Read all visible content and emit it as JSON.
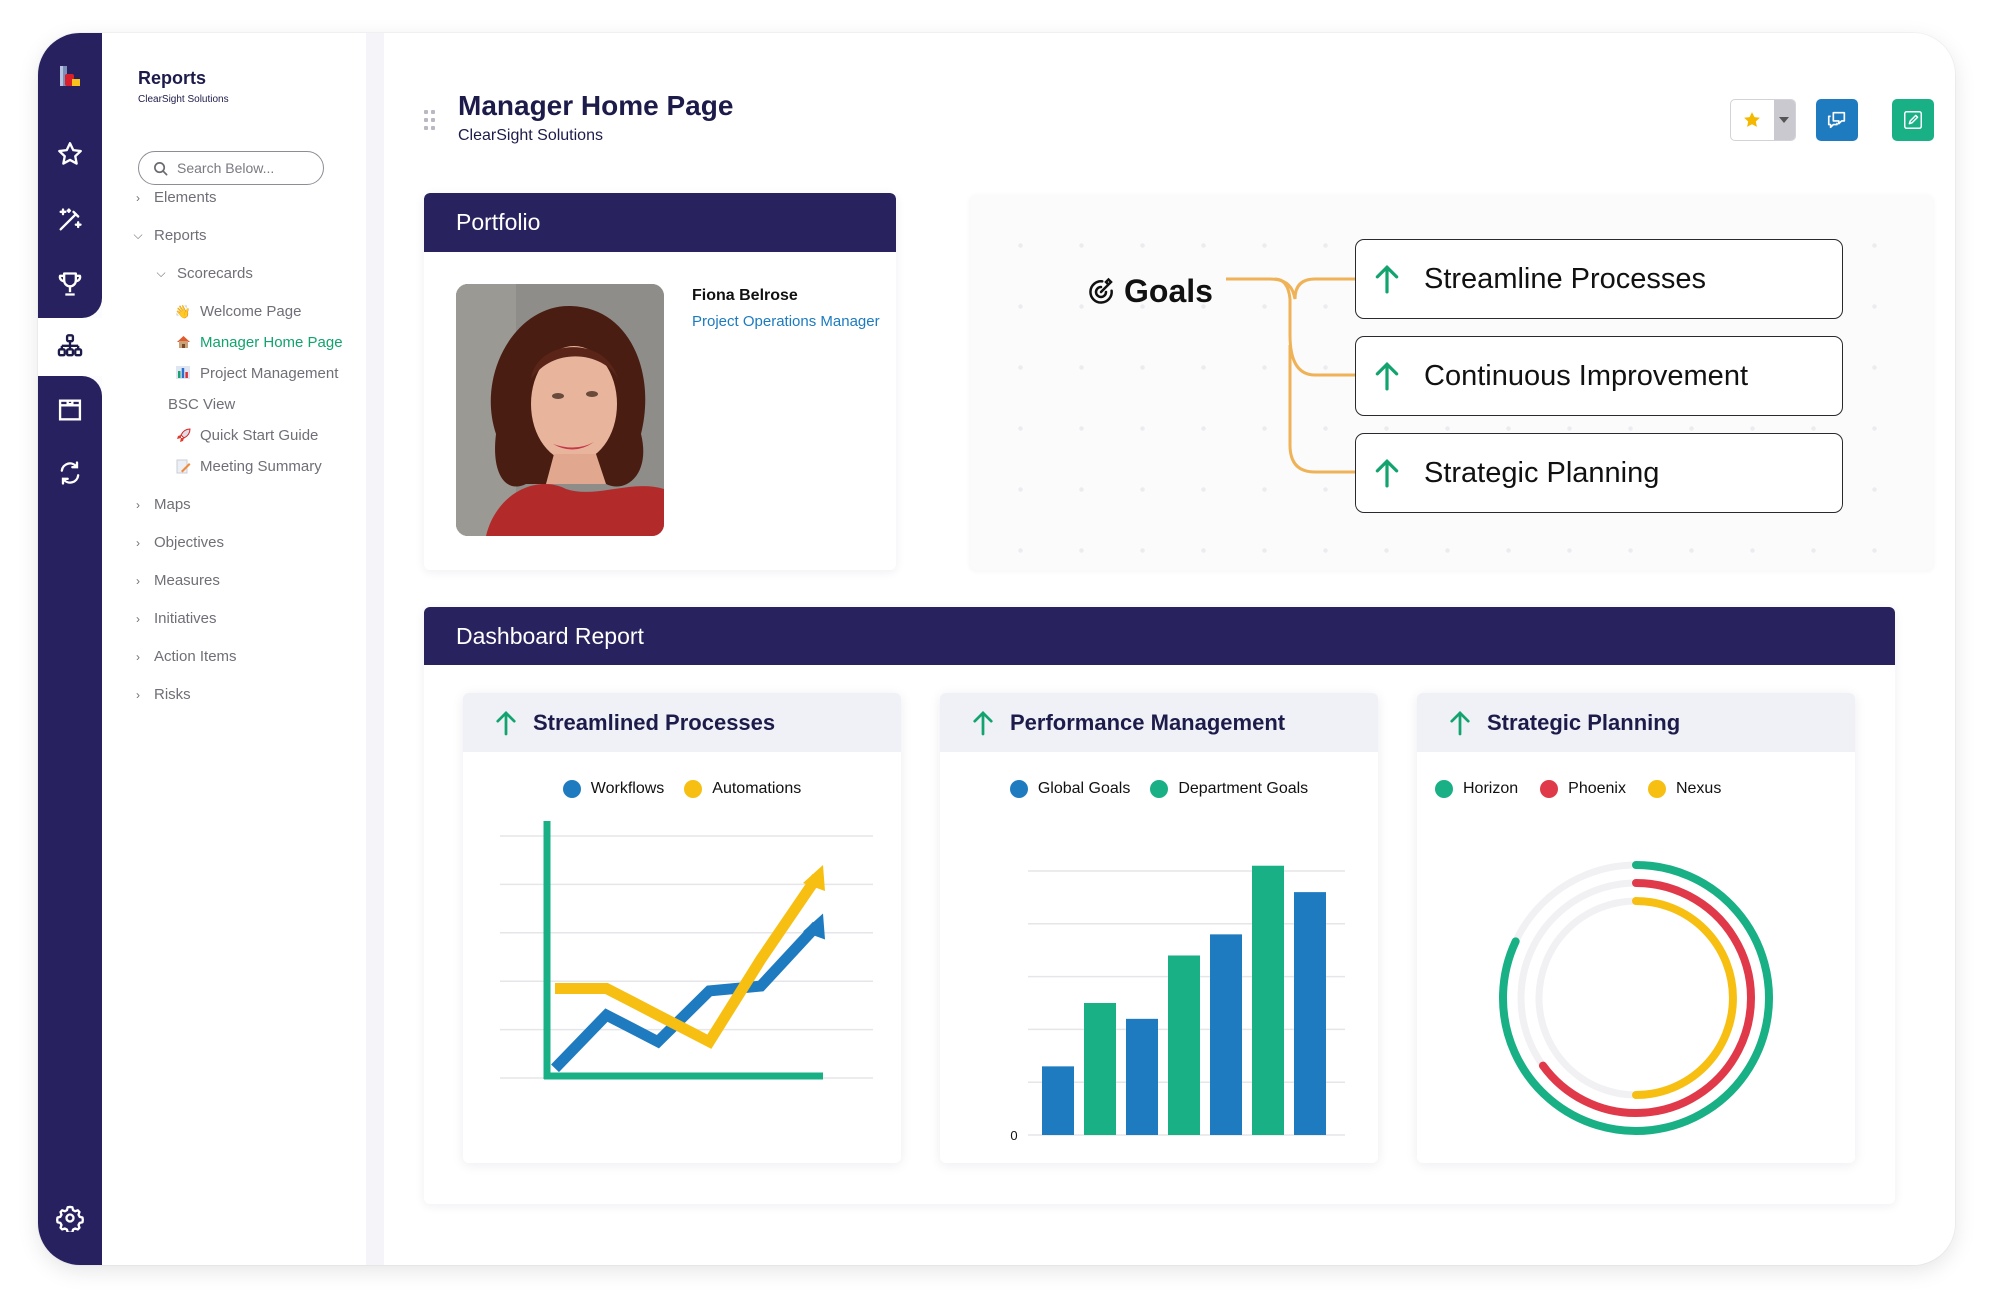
{
  "rail": {
    "items": [
      {
        "name": "app-logo-icon"
      },
      {
        "name": "favorites-star-icon"
      },
      {
        "name": "magic-wand-icon"
      },
      {
        "name": "trophy-icon"
      },
      {
        "name": "hierarchy-icon",
        "active": true
      },
      {
        "name": "archive-box-icon"
      },
      {
        "name": "sync-icon"
      },
      {
        "name": "settings-gear-icon"
      }
    ]
  },
  "nav": {
    "title": "Reports",
    "subtitle": "ClearSight Solutions",
    "search_placeholder": "Search Below...",
    "tree": [
      {
        "label": "Elements",
        "state": "collapsed",
        "level": 0
      },
      {
        "label": "Reports",
        "state": "expanded",
        "level": 0
      },
      {
        "label": "Scorecards",
        "state": "expanded",
        "level": 1
      },
      {
        "label": "Welcome Page",
        "icon": "hand-icon",
        "level": 2
      },
      {
        "label": "Manager Home Page",
        "icon": "house-icon",
        "level": 2,
        "active": true
      },
      {
        "label": "Project Management",
        "icon": "bar-chart-icon",
        "level": 2
      },
      {
        "label": "BSC View",
        "icon": null,
        "level": 2
      },
      {
        "label": "Quick Start Guide",
        "icon": "rocket-icon",
        "level": 2
      },
      {
        "label": "Meeting Summary",
        "icon": "memo-icon",
        "level": 2
      },
      {
        "label": "Maps",
        "state": "collapsed",
        "level": 0
      },
      {
        "label": "Objectives",
        "state": "collapsed",
        "level": 0
      },
      {
        "label": "Measures",
        "state": "collapsed",
        "level": 0
      },
      {
        "label": "Initiatives",
        "state": "collapsed",
        "level": 0
      },
      {
        "label": "Action Items",
        "state": "collapsed",
        "level": 0
      },
      {
        "label": "Risks",
        "state": "collapsed",
        "level": 0
      }
    ]
  },
  "header": {
    "title": "Manager Home Page",
    "subtitle": "ClearSight Solutions",
    "toolbar": {
      "favorite_icon": "star-icon",
      "favorite_menu_icon": "caret-down-icon",
      "comments_icon": "chat-bubbles-icon",
      "edit_icon": "edit-pencil-icon"
    }
  },
  "portfolio": {
    "title": "Portfolio",
    "name": "Fiona Belrose",
    "role": "Project Operations Manager"
  },
  "goals": {
    "label": "Goals",
    "items": [
      {
        "label": "Streamline Processes",
        "trend": "up"
      },
      {
        "label": "Continuous Improvement",
        "trend": "up"
      },
      {
        "label": "Strategic Planning",
        "trend": "up"
      }
    ]
  },
  "dashboard": {
    "title": "Dashboard Report"
  },
  "colors": {
    "navy": "#28235f",
    "blue": "#1f7bc0",
    "green": "#19b086",
    "yellow": "#f7bf12",
    "red": "#e03a4a",
    "trend_up": "#12a36e",
    "connector": "#efb257"
  },
  "chart_data": [
    {
      "type": "line",
      "title": "Streamlined Processes",
      "trend": "up",
      "xlabel": "",
      "ylabel": "",
      "ylim": [
        0,
        5
      ],
      "grid": true,
      "legend": "top-center",
      "x": [
        0,
        1,
        2,
        3,
        4,
        5
      ],
      "series": [
        {
          "name": "Workflows",
          "color": "#1f7bc0",
          "values": [
            0.2,
            1.3,
            0.75,
            1.8,
            1.9,
            3.4
          ]
        },
        {
          "name": "Automations",
          "color": "#f7bf12",
          "values": [
            1.85,
            1.85,
            1.3,
            0.75,
            2.45,
            4.4
          ]
        }
      ]
    },
    {
      "type": "bar",
      "title": "Performance Management",
      "trend": "up",
      "xlabel": "",
      "ylabel": "",
      "ylim": [
        0,
        5
      ],
      "yticks": [
        "0"
      ],
      "grid": true,
      "legend": "top-center",
      "series": [
        {
          "name": "Global Goals",
          "color": "#1f7bc0"
        },
        {
          "name": "Department Goals",
          "color": "#19b086"
        }
      ],
      "bars": [
        {
          "series": "Global Goals",
          "value": 1.3
        },
        {
          "series": "Department Goals",
          "value": 2.5
        },
        {
          "series": "Global Goals",
          "value": 2.2
        },
        {
          "series": "Department Goals",
          "value": 3.4
        },
        {
          "series": "Global Goals",
          "value": 3.8
        },
        {
          "series": "Department Goals",
          "value": 5.1
        },
        {
          "series": "Global Goals",
          "value": 4.6
        }
      ]
    },
    {
      "type": "radial-bar",
      "title": "Strategic Planning",
      "trend": "up",
      "legend": "top-center",
      "unit": "percent",
      "series": [
        {
          "name": "Horizon",
          "color": "#19b086",
          "value": 82
        },
        {
          "name": "Phoenix",
          "color": "#e03a4a",
          "value": 65
        },
        {
          "name": "Nexus",
          "color": "#f7bf12",
          "value": 50
        }
      ]
    }
  ]
}
